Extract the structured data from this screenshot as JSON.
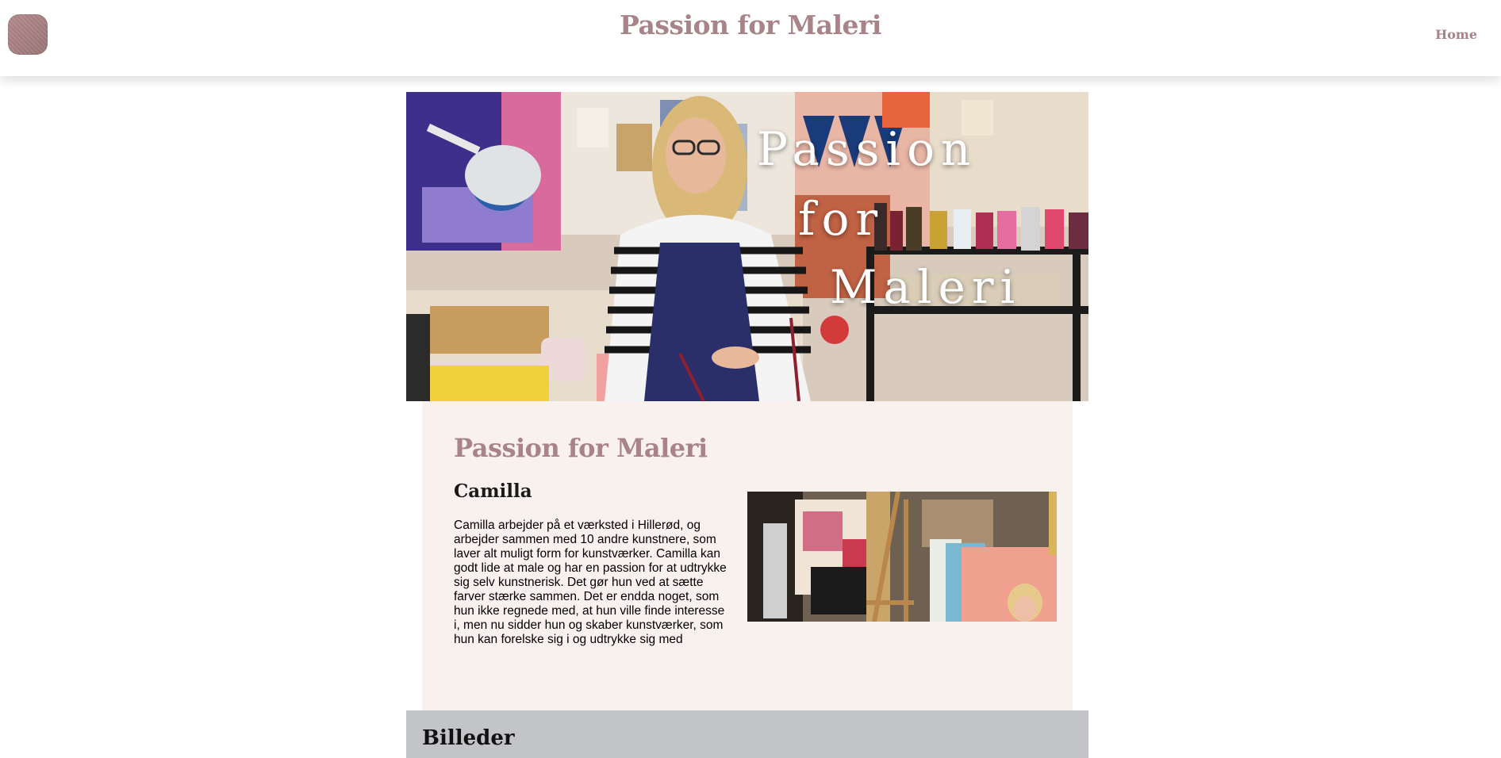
{
  "header": {
    "site_title": "Passion for Maleri",
    "nav_home": "Home"
  },
  "hero": {
    "line1": "Passion",
    "line2": "for",
    "line3": "Maleri"
  },
  "about": {
    "heading": "Passion for Maleri",
    "name": "Camilla",
    "bio": "Camilla arbejder på et værksted i Hillerød, og arbejder sammen med 10 andre kunstnere, som laver alt muligt form for kunstværker. Camilla kan godt lide at male og har en passion for at udtrykke sig selv kunstnerisk. Det gør hun ved at sætte farver stærke sammen. Det er endda noget, som hun ikke regnede med, at hun ville finde interesse i, men nu sidder hun og skaber kunstværker, som hun kan forelske sig i og udtrykke sig med"
  },
  "gallery": {
    "title": "Billeder"
  },
  "colors": {
    "accent": "#a88387",
    "panel_bg": "#f9f1ee",
    "gallery_bg": "#c2c4c8"
  }
}
